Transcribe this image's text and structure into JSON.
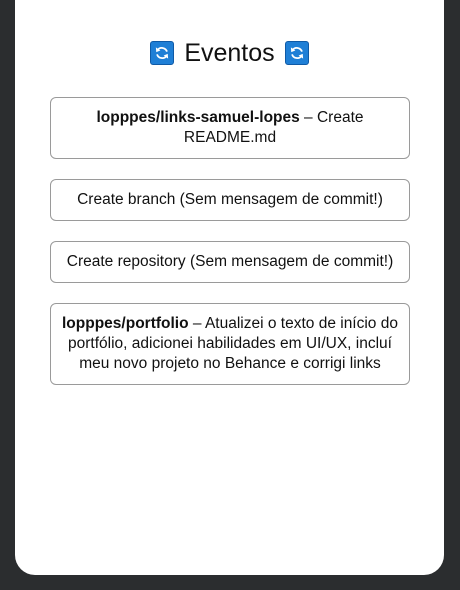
{
  "header": {
    "title": "Eventos",
    "icon": "refresh-emoji-icon"
  },
  "events": [
    {
      "repo": "lopppes/links-samuel-lopes",
      "message": "Create README.md"
    },
    {
      "repo": "",
      "message": "Create branch (Sem mensagem de commit!)"
    },
    {
      "repo": "",
      "message": "Create repository (Sem mensagem de commit!)"
    },
    {
      "repo": "lopppes/portfolio",
      "message": "Atualizei o texto de início do portfólio, adicionei habilidades em UI/UX, incluí meu novo projeto no Behance e corrigi links"
    }
  ],
  "separator": " – ",
  "colors": {
    "background": "#2b2d2f",
    "card": "#ffffff",
    "icon": "#1f7fd6",
    "border": "#9a9a9a"
  }
}
